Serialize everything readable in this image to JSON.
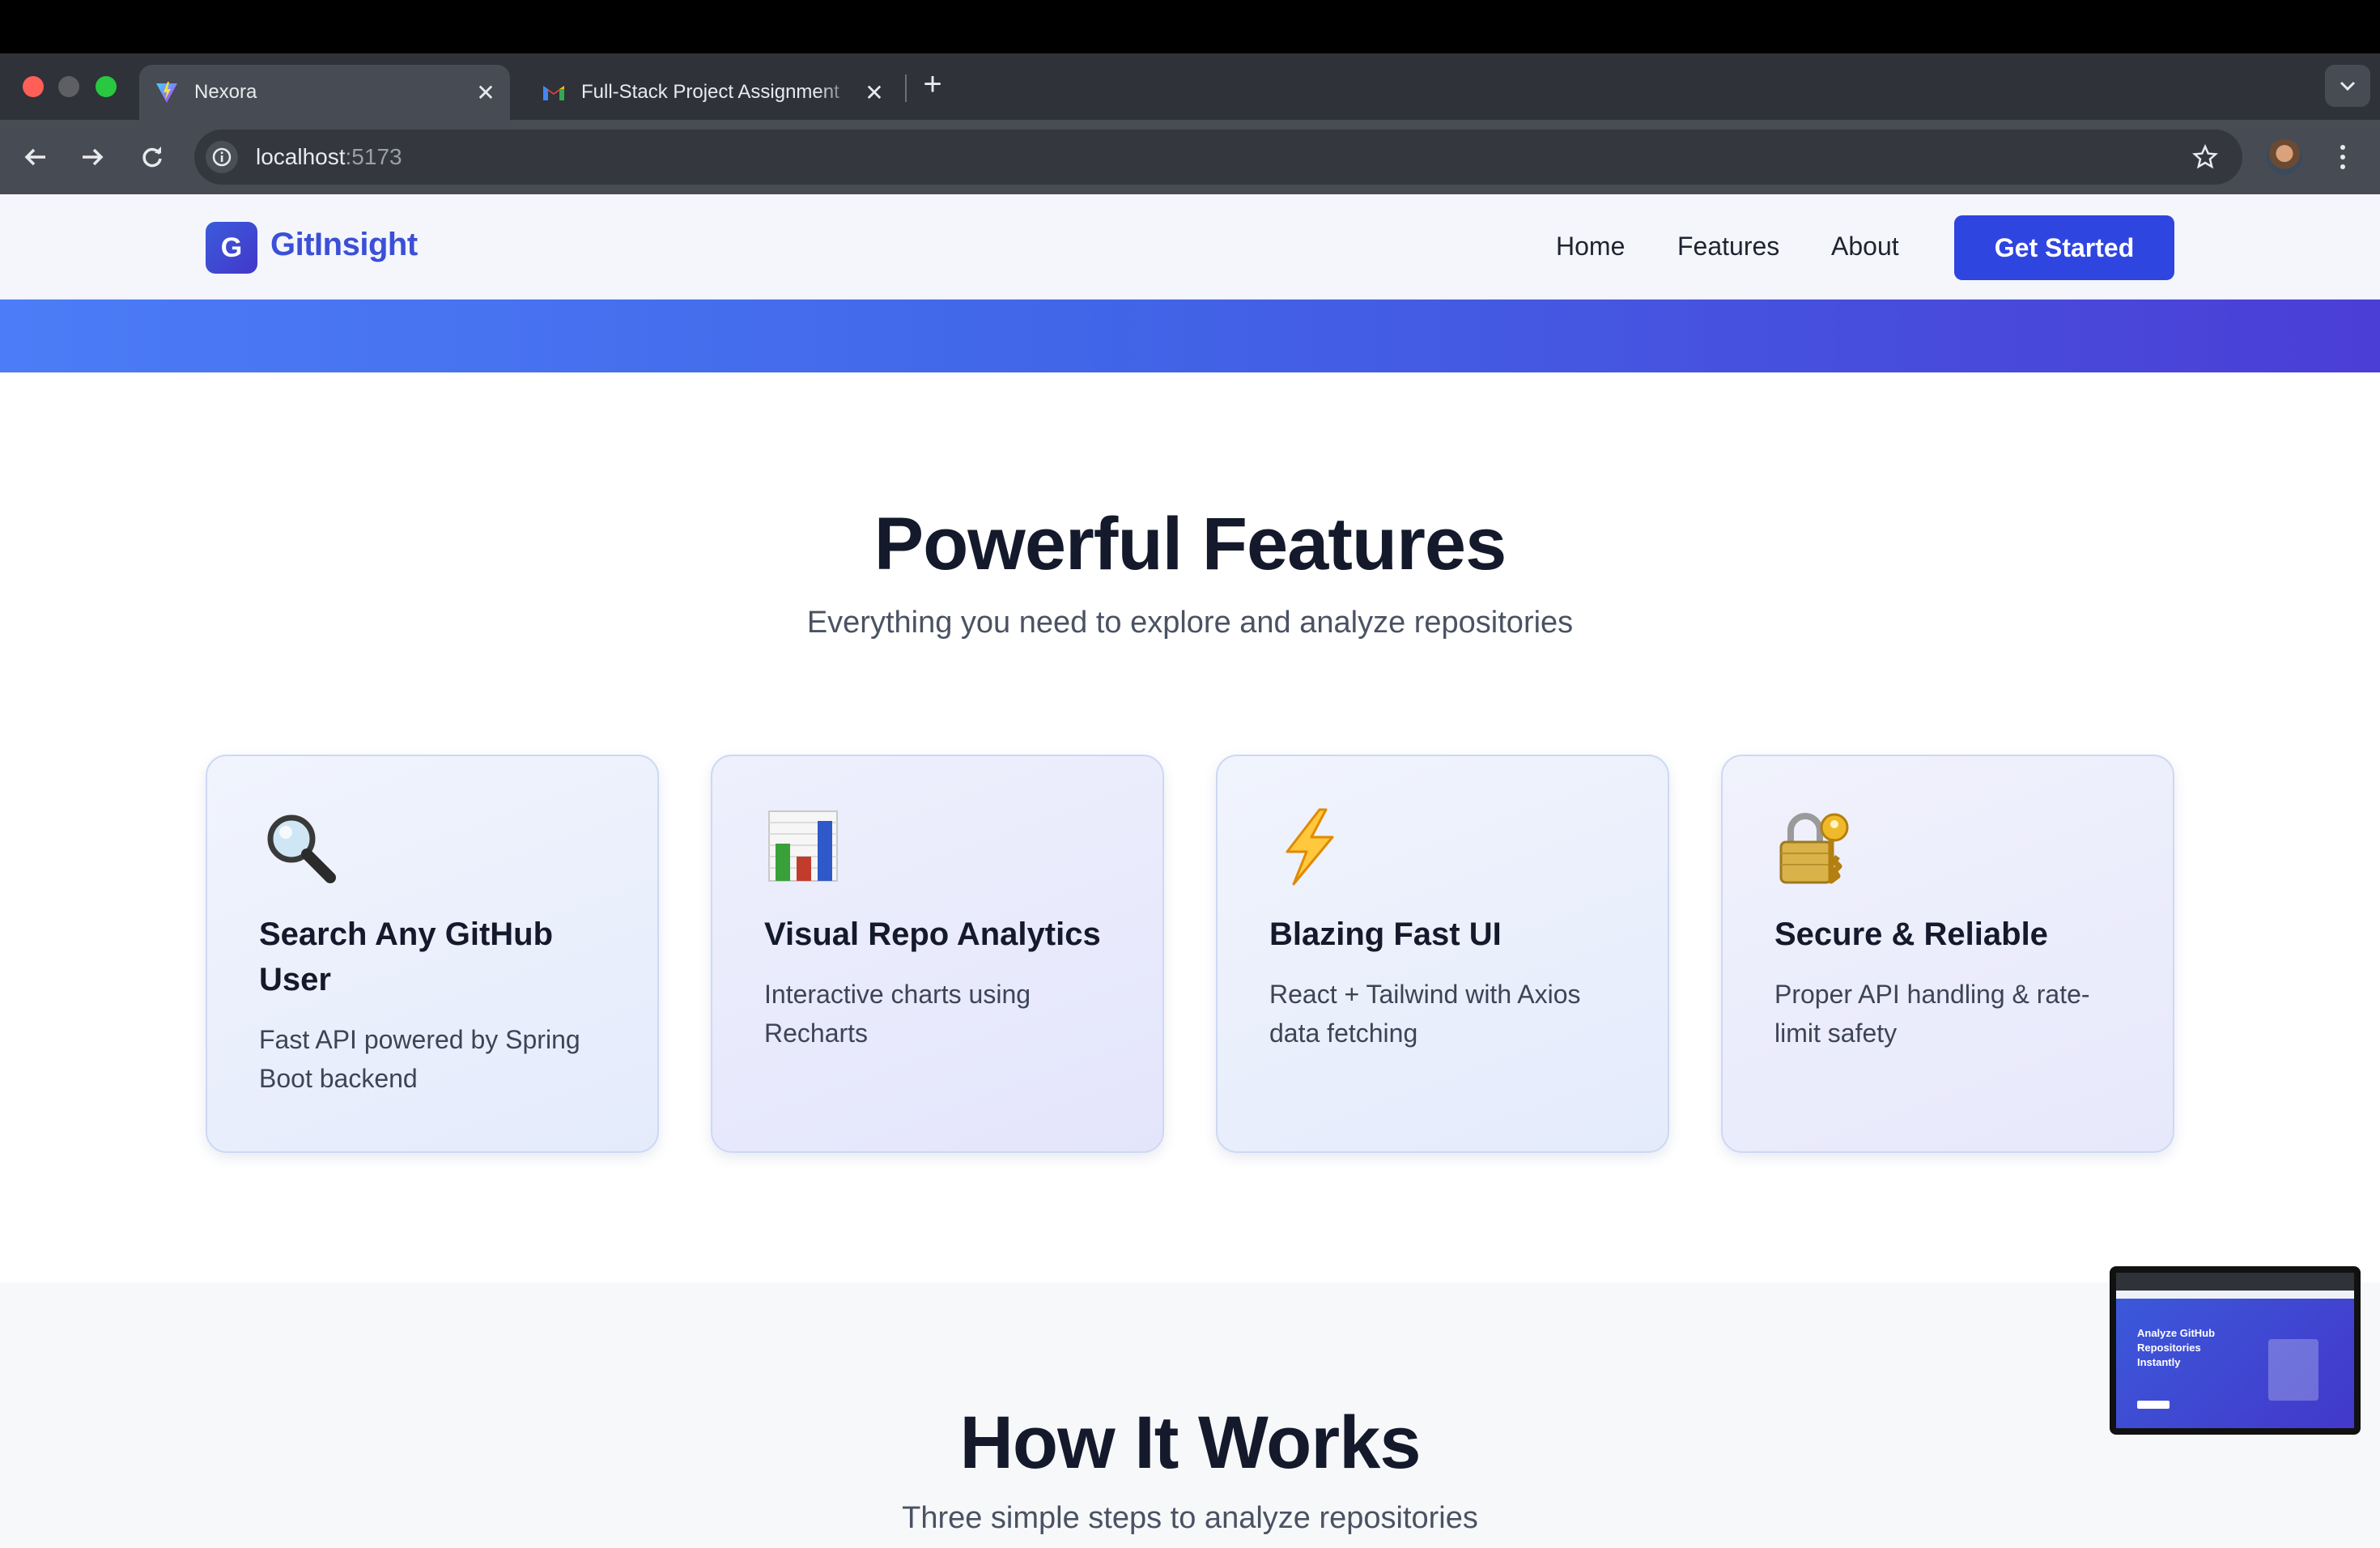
{
  "browser": {
    "tabs": [
      {
        "title": "Nexora",
        "active": true,
        "favicon": "vite-icon"
      },
      {
        "title": "Full-Stack Project Assignment",
        "active": false,
        "favicon": "gmail-icon"
      }
    ],
    "address": {
      "host": "localhost",
      "port": ":5173"
    }
  },
  "site": {
    "logo_letter": "G",
    "brand": "GitInsight",
    "nav": {
      "home": "Home",
      "features": "Features",
      "about": "About"
    },
    "cta": "Get Started"
  },
  "features": {
    "title": "Powerful Features",
    "subtitle": "Everything you need to explore and analyze repositories",
    "cards": [
      {
        "icon": "magnifier-icon",
        "title": "Search Any GitHub User",
        "desc": "Fast API powered by Spring Boot backend"
      },
      {
        "icon": "bar-chart-icon",
        "title": "Visual Repo Analytics",
        "desc": "Interactive charts using Recharts"
      },
      {
        "icon": "lightning-icon",
        "title": "Blazing Fast UI",
        "desc": "React + Tailwind with Axios data fetching"
      },
      {
        "icon": "lock-key-icon",
        "title": "Secure & Reliable",
        "desc": "Proper API handling & rate-limit safety"
      }
    ]
  },
  "how": {
    "title": "How It Works",
    "subtitle": "Three simple steps to analyze repositories"
  },
  "preview": {
    "hero_text": "Analyze GitHub Repositories Instantly"
  },
  "colors": {
    "brand": "#2f45e0",
    "heading": "#141a2b",
    "gradient_start": "#4c7cf7",
    "gradient_end": "#4b3ed6"
  }
}
